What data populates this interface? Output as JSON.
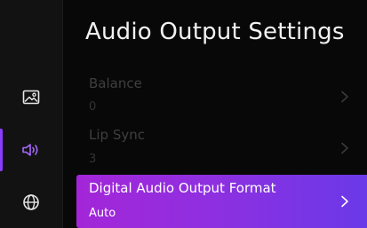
{
  "page": {
    "title": "Audio Output Settings"
  },
  "rail": {
    "items": [
      {
        "icon": "picture-settings-icon",
        "active": false
      },
      {
        "icon": "sound-icon",
        "active": true
      },
      {
        "icon": "globe-icon",
        "active": false
      }
    ],
    "accent_color": "#8a3dff"
  },
  "menu": {
    "items": [
      {
        "label": "Balance",
        "value": "0",
        "state": "dimmed"
      },
      {
        "label": "Lip Sync",
        "value": "3",
        "state": "dimmed"
      },
      {
        "label": "Digital Audio Output Format",
        "value": "Auto",
        "state": "selected"
      }
    ],
    "selected_gradient": [
      "#a326d8",
      "#6a39e8"
    ]
  }
}
